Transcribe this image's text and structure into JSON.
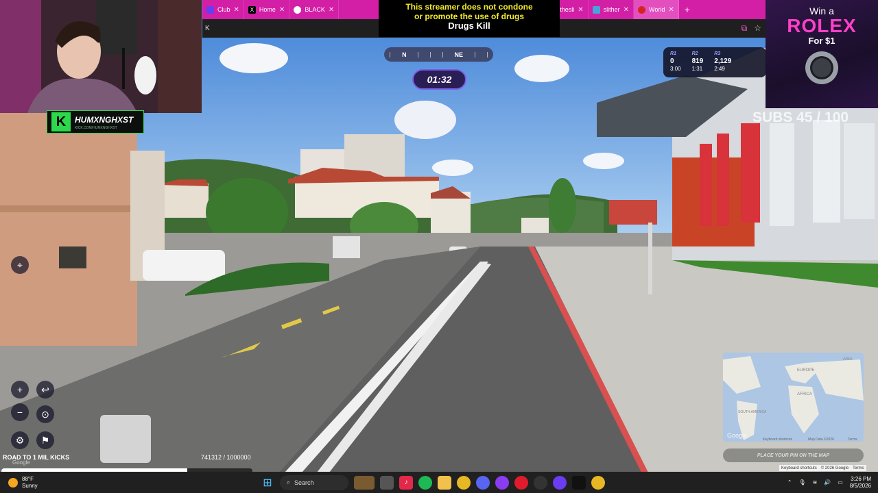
{
  "browser": {
    "tabs": [
      {
        "label": "Club",
        "color": "#6a3df0"
      },
      {
        "label": "Home",
        "color": "#000000"
      },
      {
        "label": "BLACK",
        "color": "#3a8a3a"
      },
      {
        "label": "thesli",
        "color": "#2bd94b"
      },
      {
        "label": "slither",
        "color": "#4aa3d8"
      },
      {
        "label": "World",
        "color": "#d32424"
      }
    ],
    "address_text": "K"
  },
  "disclaimer": {
    "line1": "This streamer does not condone",
    "line2": "or promote the use of drugs",
    "line3": "Drugs Kill"
  },
  "streamer": {
    "name": "HUMXNGHXST",
    "channel": "KICK.COM/HUMXNGHXST"
  },
  "ad": {
    "line1": "Win a",
    "brand": "ROLEX",
    "price": "For $1"
  },
  "compass": {
    "labels": [
      "N",
      "NE"
    ]
  },
  "timer": "01:32",
  "rounds": [
    {
      "label": "R1",
      "score": "0",
      "time": "3:00"
    },
    {
      "label": "R2",
      "score": "819",
      "time": "1:31"
    },
    {
      "label": "R3",
      "score": "2,129",
      "time": "2:49"
    }
  ],
  "subs_goal": "SUBS 45 / 100",
  "kicks": {
    "title": "ROAD TO 1 MIL KICKS",
    "count_text": "741312 / 1000000",
    "progress": 0.741
  },
  "map": {
    "pin_button": "PLACE YOUR PIN ON THE MAP",
    "google": "Google",
    "attribution": [
      "Keyboard shortcuts",
      "Map Data ©2026",
      "Terms"
    ],
    "labels": [
      "EUROPE",
      "AFRICA",
      "SOUTH AMERICA",
      "ASIA"
    ]
  },
  "scene_google": "Google",
  "scene_attribution": [
    "Keyboard shortcuts",
    "© 2026 Google",
    "Terms"
  ],
  "taskbar": {
    "weather_temp": "88°F",
    "weather_desc": "Sunny",
    "search_label": "Search",
    "time": "3:26 PM",
    "date": "8/5/2026"
  },
  "colors": {
    "tab_bar": "#d31ea6",
    "accent_pink": "#ff3fc7",
    "kick_green": "#2bd94b"
  }
}
